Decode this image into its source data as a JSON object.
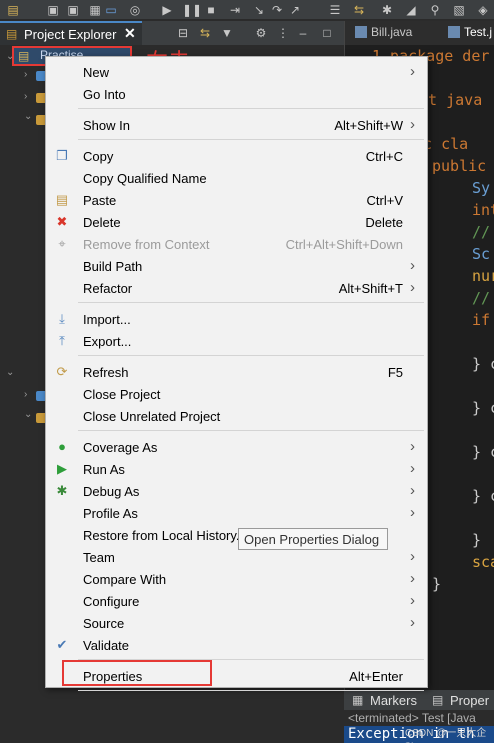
{
  "explorer": {
    "tab_label": "Project Explorer",
    "close_glyph": "✕",
    "project_name": "Practise",
    "annotation": "右击"
  },
  "editor": {
    "tabs": [
      "Bill.java",
      "Test.j"
    ],
    "lines": [
      {
        "text": "1 package der",
        "color": "#cc7832"
      },
      {
        "text": "ort java",
        "color": "#cc7832"
      },
      {
        "text": "lic cla",
        "color": "#cc7832"
      },
      {
        "text": "public",
        "color": "#cc7832"
      },
      {
        "text": "Sy",
        "color": "#6a9fd4"
      },
      {
        "text": "int",
        "color": "#cc7832"
      },
      {
        "text": "//",
        "color": "#629755"
      },
      {
        "text": "Sc",
        "color": "#6a9fd4"
      },
      {
        "text": "nur",
        "color": "#d9a441"
      },
      {
        "text": "//",
        "color": "#629755"
      },
      {
        "text": "if",
        "color": "#cc7832"
      },
      {
        "text": "} c",
        "color": "#cccccc"
      },
      {
        "text": "} c",
        "color": "#cccccc"
      },
      {
        "text": "} c",
        "color": "#cccccc"
      },
      {
        "text": "} c",
        "color": "#cccccc"
      },
      {
        "text": "}",
        "color": "#cccccc"
      },
      {
        "text": "sca",
        "color": "#d9a441"
      },
      {
        "text": "}",
        "color": "#cccccc"
      }
    ]
  },
  "bottom_panel": {
    "tabs": [
      "Markers",
      "Proper"
    ],
    "status": "<terminated> Test [Java",
    "exception": "Exception in th",
    "watermark": "CSDN @一只大企鹅"
  },
  "context_menu": {
    "items": [
      {
        "label": "New",
        "shortcut": "",
        "submenu": true,
        "icon": "",
        "icon_color": ""
      },
      {
        "label": "Go Into",
        "shortcut": "",
        "submenu": false,
        "icon": "",
        "icon_color": ""
      },
      {
        "label": "Show In",
        "shortcut": "Alt+Shift+W",
        "submenu": true,
        "icon": "",
        "icon_color": ""
      },
      {
        "label": "Copy",
        "shortcut": "Ctrl+C",
        "submenu": false,
        "icon": "copy-icon",
        "icon_color": "#4a7ab5"
      },
      {
        "label": "Copy Qualified Name",
        "shortcut": "",
        "submenu": false,
        "icon": "",
        "icon_color": ""
      },
      {
        "label": "Paste",
        "shortcut": "Ctrl+V",
        "submenu": false,
        "icon": "paste-icon",
        "icon_color": "#c29b4a"
      },
      {
        "label": "Delete",
        "shortcut": "Delete",
        "submenu": false,
        "icon": "delete-icon",
        "icon_color": "#d9362b"
      },
      {
        "label": "Remove from Context",
        "shortcut": "Ctrl+Alt+Shift+Down",
        "submenu": false,
        "icon": "remove-context-icon",
        "icon_color": "#a0a0a0",
        "disabled": true
      },
      {
        "label": "Build Path",
        "shortcut": "",
        "submenu": true,
        "icon": "",
        "icon_color": ""
      },
      {
        "label": "Refactor",
        "shortcut": "Alt+Shift+T",
        "submenu": true,
        "icon": "",
        "icon_color": ""
      },
      {
        "label": "Import...",
        "shortcut": "",
        "submenu": false,
        "icon": "import-icon",
        "icon_color": "#5a8ac0"
      },
      {
        "label": "Export...",
        "shortcut": "",
        "submenu": false,
        "icon": "export-icon",
        "icon_color": "#5a8ac0"
      },
      {
        "label": "Refresh",
        "shortcut": "F5",
        "submenu": false,
        "icon": "refresh-icon",
        "icon_color": "#c29b4a"
      },
      {
        "label": "Close Project",
        "shortcut": "",
        "submenu": false,
        "icon": "",
        "icon_color": ""
      },
      {
        "label": "Close Unrelated Project",
        "shortcut": "",
        "submenu": false,
        "icon": "",
        "icon_color": ""
      },
      {
        "label": "Coverage As",
        "shortcut": "",
        "submenu": true,
        "icon": "coverage-icon",
        "icon_color": "#2e9e3a"
      },
      {
        "label": "Run As",
        "shortcut": "",
        "submenu": true,
        "icon": "run-icon",
        "icon_color": "#2e9e3a"
      },
      {
        "label": "Debug As",
        "shortcut": "",
        "submenu": true,
        "icon": "debug-icon",
        "icon_color": "#3a8a3a"
      },
      {
        "label": "Profile As",
        "shortcut": "",
        "submenu": true,
        "icon": "",
        "icon_color": ""
      },
      {
        "label": "Restore from Local History...",
        "shortcut": "",
        "submenu": false,
        "icon": "",
        "icon_color": ""
      },
      {
        "label": "Team",
        "shortcut": "",
        "submenu": true,
        "icon": "",
        "icon_color": ""
      },
      {
        "label": "Compare With",
        "shortcut": "",
        "submenu": true,
        "icon": "",
        "icon_color": ""
      },
      {
        "label": "Configure",
        "shortcut": "",
        "submenu": true,
        "icon": "",
        "icon_color": ""
      },
      {
        "label": "Source",
        "shortcut": "",
        "submenu": true,
        "icon": "",
        "icon_color": ""
      },
      {
        "label": "Validate",
        "shortcut": "",
        "submenu": false,
        "icon": "validate-icon",
        "icon_color": "#4a7ab5"
      },
      {
        "label": "Properties",
        "shortcut": "Alt+Enter",
        "submenu": false,
        "icon": "",
        "icon_color": ""
      }
    ],
    "submenu_arrow": "›"
  },
  "tooltip": {
    "text": "Open Properties Dialog"
  }
}
